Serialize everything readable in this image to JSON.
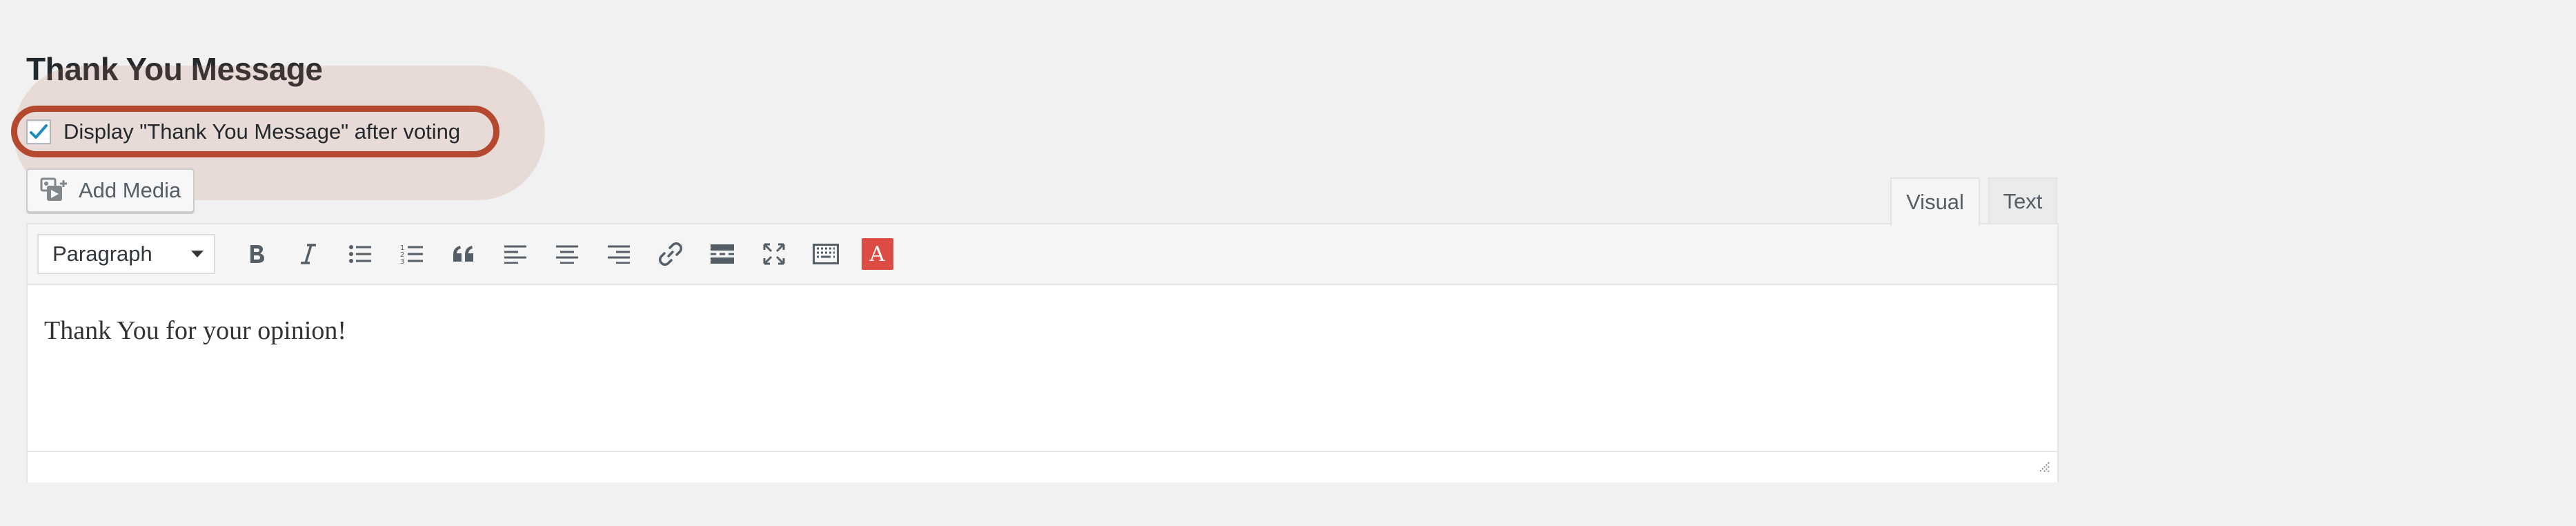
{
  "section": {
    "title": "Thank You Message"
  },
  "option": {
    "checkbox_label": "Display \"Thank You Message\" after voting",
    "checked": true
  },
  "media": {
    "add_media_label": "Add Media",
    "icon": "add-media-icon"
  },
  "editor_tabs": {
    "visual_label": "Visual",
    "text_label": "Text",
    "active": "Visual"
  },
  "toolbar": {
    "format_selected": "Paragraph",
    "buttons": [
      "bold",
      "italic",
      "bulleted-list",
      "numbered-list",
      "blockquote",
      "align-left",
      "align-center",
      "align-right",
      "insert-link",
      "read-more",
      "fullscreen",
      "toolbar-toggle",
      "text-color"
    ],
    "text_color_label": "A",
    "text_color": "#dc4c44"
  },
  "content": {
    "body": "Thank You for your opinion!"
  },
  "colors": {
    "highlight_ring": "#b5492f",
    "checkbox_check": "#1e8cbe"
  }
}
